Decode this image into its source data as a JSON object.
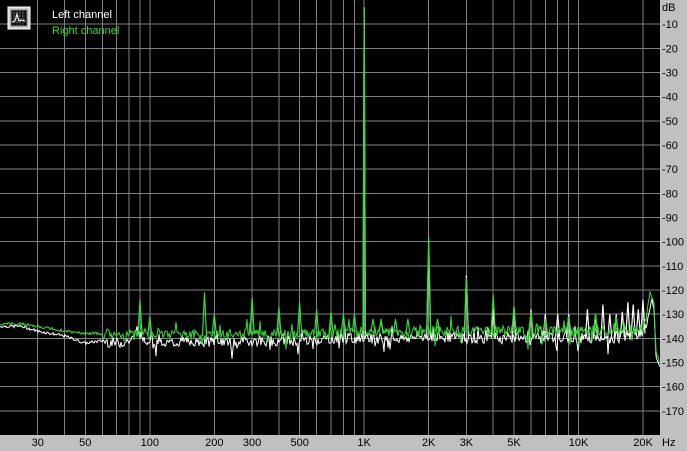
{
  "colors": {
    "plot_bg": "#000000",
    "frame_bg": "#c0c0c0",
    "grid": "#808080",
    "left": "#ffffff",
    "right": "#33dd33"
  },
  "icons": {
    "legend": "grid-toggle-icon"
  },
  "chart_data": {
    "type": "line",
    "x_scale": "log",
    "xlim": [
      20,
      24000
    ],
    "ylim": [
      -180,
      0
    ],
    "ylabel": "dB",
    "xlabel": "Hz",
    "x_ticks": [
      {
        "v": 30,
        "label": "30"
      },
      {
        "v": 50,
        "label": "50"
      },
      {
        "v": 100,
        "label": "100"
      },
      {
        "v": 200,
        "label": "200"
      },
      {
        "v": 300,
        "label": "300"
      },
      {
        "v": 500,
        "label": "500"
      },
      {
        "v": 1000,
        "label": "1K"
      },
      {
        "v": 2000,
        "label": "2K"
      },
      {
        "v": 3000,
        "label": "3K"
      },
      {
        "v": 5000,
        "label": "5K"
      },
      {
        "v": 10000,
        "label": "10K"
      },
      {
        "v": 20000,
        "label": "20K"
      }
    ],
    "y_ticks": [
      {
        "v": -10,
        "label": "-10"
      },
      {
        "v": -20,
        "label": "-20"
      },
      {
        "v": -30,
        "label": "-30"
      },
      {
        "v": -40,
        "label": "-40"
      },
      {
        "v": -50,
        "label": "-50"
      },
      {
        "v": -60,
        "label": "-60"
      },
      {
        "v": -70,
        "label": "-70"
      },
      {
        "v": -80,
        "label": "-80"
      },
      {
        "v": -90,
        "label": "-90"
      },
      {
        "v": -100,
        "label": "-100"
      },
      {
        "v": -110,
        "label": "-110"
      },
      {
        "v": -120,
        "label": "-120"
      },
      {
        "v": -130,
        "label": "-130"
      },
      {
        "v": -140,
        "label": "-140"
      },
      {
        "v": -150,
        "label": "-150"
      },
      {
        "v": -160,
        "label": "-160"
      },
      {
        "v": -170,
        "label": "-170"
      }
    ],
    "legend_position": "top-left",
    "series": [
      {
        "name": "Left channel",
        "color": "#ffffff",
        "points": [
          [
            20,
            -135
          ],
          [
            25,
            -135
          ],
          [
            30,
            -137
          ],
          [
            40,
            -139
          ],
          [
            50,
            -142
          ],
          [
            60,
            -141
          ],
          [
            70,
            -142
          ],
          [
            80,
            -141
          ],
          [
            90,
            -139
          ],
          [
            100,
            -141
          ],
          [
            120,
            -142
          ],
          [
            150,
            -141
          ],
          [
            180,
            -142
          ],
          [
            200,
            -141
          ],
          [
            250,
            -142
          ],
          [
            300,
            -141
          ],
          [
            400,
            -141
          ],
          [
            500,
            -141
          ],
          [
            700,
            -140
          ],
          [
            1000,
            -140
          ],
          [
            1500,
            -140
          ],
          [
            2000,
            -139
          ],
          [
            3000,
            -140
          ],
          [
            5000,
            -140
          ],
          [
            7000,
            -139
          ],
          [
            10000,
            -140
          ],
          [
            15000,
            -140
          ],
          [
            20000,
            -138
          ],
          [
            21000,
            -132
          ],
          [
            22000,
            -124
          ],
          [
            22500,
            -128
          ],
          [
            23000,
            -148
          ],
          [
            24000,
            -152
          ]
        ],
        "spikes": [
          [
            1000,
            -3
          ],
          [
            2000,
            -102
          ],
          [
            3000,
            -114
          ],
          [
            4000,
            -128
          ],
          [
            5000,
            -127
          ],
          [
            6000,
            -128
          ],
          [
            7000,
            -130
          ],
          [
            8000,
            -130
          ],
          [
            9000,
            -130
          ],
          [
            11000,
            -128
          ],
          [
            12000,
            -130
          ],
          [
            13000,
            -126
          ],
          [
            14000,
            -130
          ],
          [
            15000,
            -130
          ],
          [
            16000,
            -129
          ],
          [
            17000,
            -125
          ],
          [
            18000,
            -126
          ],
          [
            19000,
            -128
          ],
          [
            20000,
            -124
          ]
        ]
      },
      {
        "name": "Right channel",
        "color": "#33dd33",
        "points": [
          [
            20,
            -134
          ],
          [
            25,
            -134
          ],
          [
            30,
            -135
          ],
          [
            40,
            -137
          ],
          [
            50,
            -138
          ],
          [
            60,
            -138
          ],
          [
            70,
            -139
          ],
          [
            80,
            -139
          ],
          [
            90,
            -138
          ],
          [
            100,
            -139
          ],
          [
            120,
            -138
          ],
          [
            150,
            -138
          ],
          [
            180,
            -139
          ],
          [
            200,
            -138
          ],
          [
            250,
            -138
          ],
          [
            300,
            -138
          ],
          [
            400,
            -138
          ],
          [
            500,
            -138
          ],
          [
            700,
            -138
          ],
          [
            1000,
            -137
          ],
          [
            1500,
            -138
          ],
          [
            2000,
            -137
          ],
          [
            3000,
            -137
          ],
          [
            5000,
            -137
          ],
          [
            7000,
            -137
          ],
          [
            10000,
            -137
          ],
          [
            15000,
            -137
          ],
          [
            20000,
            -136
          ],
          [
            21000,
            -128
          ],
          [
            21500,
            -121
          ],
          [
            22000,
            -123
          ],
          [
            22500,
            -126
          ],
          [
            23000,
            -146
          ],
          [
            24000,
            -150
          ]
        ],
        "spikes": [
          [
            90,
            -124
          ],
          [
            100,
            -131
          ],
          [
            180,
            -121
          ],
          [
            200,
            -130
          ],
          [
            300,
            -123
          ],
          [
            400,
            -127
          ],
          [
            500,
            -125
          ],
          [
            600,
            -128
          ],
          [
            700,
            -129
          ],
          [
            800,
            -130
          ],
          [
            900,
            -130
          ],
          [
            1000,
            -3
          ],
          [
            1100,
            -132
          ],
          [
            1200,
            -132
          ],
          [
            1400,
            -132
          ],
          [
            1600,
            -132
          ],
          [
            2000,
            -98
          ],
          [
            2200,
            -132
          ],
          [
            3000,
            -115
          ],
          [
            4000,
            -122
          ],
          [
            5000,
            -127
          ],
          [
            6000,
            -129
          ],
          [
            7000,
            -132
          ],
          [
            9000,
            -131
          ],
          [
            12000,
            -130
          ],
          [
            15000,
            -131
          ]
        ]
      }
    ]
  }
}
